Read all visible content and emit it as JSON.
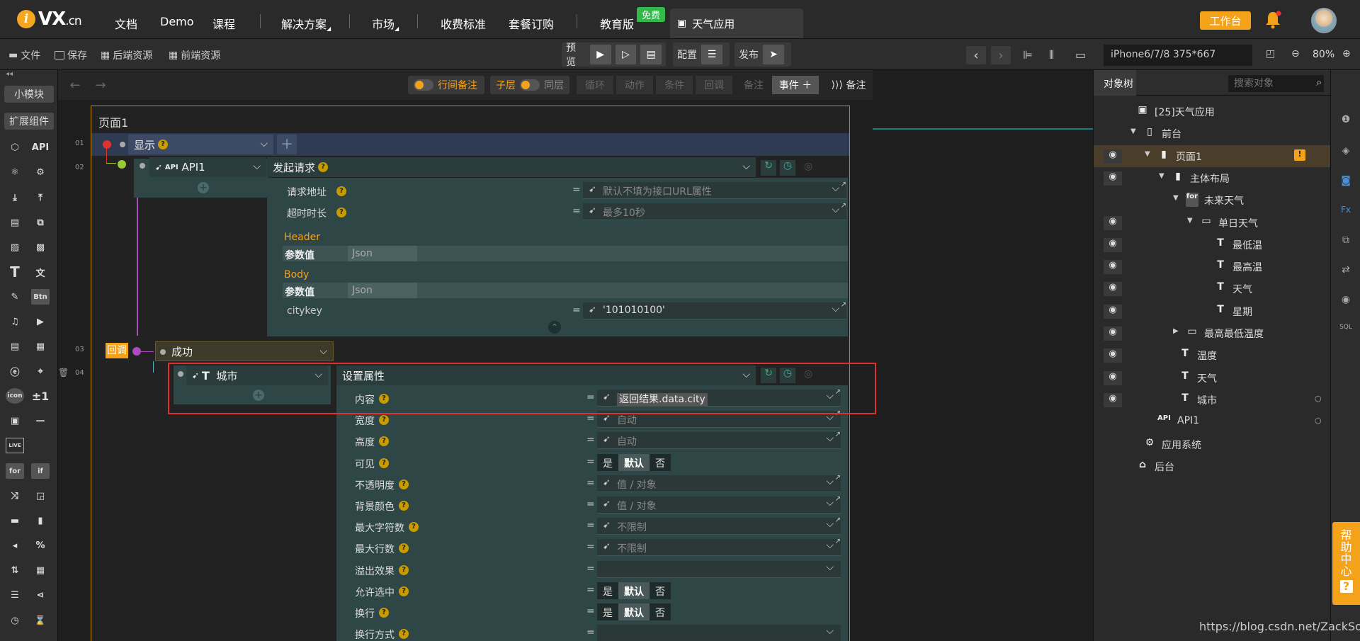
{
  "topnav": {
    "logo_main": "VX",
    "logo_suffix": ".cn",
    "items": [
      "文档",
      "Demo",
      "课程",
      "解决方案",
      "市场",
      "收费标准",
      "套餐订购",
      "教育版"
    ],
    "free_badge": "免费",
    "app_tab": "天气应用",
    "workbench_button": "工作台"
  },
  "toolbar": {
    "file": "文件",
    "save": "保存",
    "backend_res": "后端资源",
    "frontend_res": "前端资源",
    "preview": "预览",
    "config": "配置",
    "publish": "发布",
    "device": "iPhone6/7/8 375*667",
    "zoom": "80%"
  },
  "palette": {
    "small_module": "小模块",
    "extensions": "扩展组件",
    "api_label": "API",
    "btn_label": "Btn",
    "pm_label": "±1",
    "icon_label": "icon",
    "live_label": "LIVE",
    "for_label": "for",
    "if_label": "if"
  },
  "editor_bar": {
    "line_note": "行间备注",
    "child_layer": "子层",
    "same_layer": "同层",
    "loop": "循环",
    "action": "动作",
    "condition": "条件",
    "callback": "回调",
    "note": "备注",
    "event": "事件",
    "note_right": "备注"
  },
  "page": {
    "title": "页面1",
    "line_numbers": [
      "01",
      "02",
      "03",
      "04"
    ],
    "show_trigger": "显示",
    "api_target": "API1",
    "api_prefix": "API",
    "api_action": "发起请求",
    "request_rows": [
      {
        "label": "请求地址",
        "placeholder": "默认不填为接口URL属性"
      },
      {
        "label": "超时时长",
        "placeholder": "最多10秒"
      }
    ],
    "header_label": "Header",
    "body_label": "Body",
    "param_label": "参数值",
    "json_label": "Json",
    "citykey_label": "citykey",
    "citykey_value": "'101010100'",
    "callback_tag": "回调",
    "success": "成功",
    "city_target": "城市",
    "set_prop_action": "设置属性",
    "props": [
      {
        "label": "内容",
        "value": "返回结果.data.city",
        "kind": "value"
      },
      {
        "label": "宽度",
        "value": "自动",
        "kind": "placeholder"
      },
      {
        "label": "高度",
        "value": "自动",
        "kind": "placeholder"
      },
      {
        "label": "可见",
        "kind": "yesno"
      },
      {
        "label": "不透明度",
        "value": "值 / 对象",
        "kind": "placeholder"
      },
      {
        "label": "背景颜色",
        "value": "值 / 对象",
        "kind": "placeholder"
      },
      {
        "label": "最大字符数",
        "value": "不限制",
        "kind": "placeholder"
      },
      {
        "label": "最大行数",
        "value": "不限制",
        "kind": "placeholder"
      },
      {
        "label": "溢出效果",
        "value": "",
        "kind": "select"
      },
      {
        "label": "允许选中",
        "kind": "yesno"
      },
      {
        "label": "换行",
        "kind": "yesno"
      },
      {
        "label": "换行方式",
        "value": "",
        "kind": "select"
      }
    ],
    "yes": "是",
    "default": "默认",
    "no": "否"
  },
  "object_tree": {
    "tab": "对象树",
    "search_placeholder": "搜索对象",
    "nodes": [
      {
        "label": "[25]天气应用",
        "eye": false
      },
      {
        "label": "前台",
        "eye": false
      },
      {
        "label": "页面1",
        "eye": true
      },
      {
        "label": "主体布局",
        "eye": true
      },
      {
        "label": "未来天气",
        "eye": false
      },
      {
        "label": "单日天气",
        "eye": true
      },
      {
        "label": "最低温",
        "eye": true
      },
      {
        "label": "最高温",
        "eye": true
      },
      {
        "label": "天气",
        "eye": true
      },
      {
        "label": "星期",
        "eye": true
      },
      {
        "label": "最高最低温度",
        "eye": true
      },
      {
        "label": "温度",
        "eye": true
      },
      {
        "label": "天气",
        "eye": true
      },
      {
        "label": "城市",
        "eye": true
      },
      {
        "label": "API1",
        "eye": false
      },
      {
        "label": "应用系统",
        "eye": false
      },
      {
        "label": "后台",
        "eye": false
      }
    ],
    "api_prefix": "API",
    "for_tag": "for"
  },
  "help": {
    "label": "帮助中心"
  },
  "watermark": "https://blog.csdn.net/ZackSock",
  "colors": {
    "accent": "#f5a21b",
    "panel": "#2f4646",
    "highlight": "#e03030",
    "free": "#31b94a"
  }
}
